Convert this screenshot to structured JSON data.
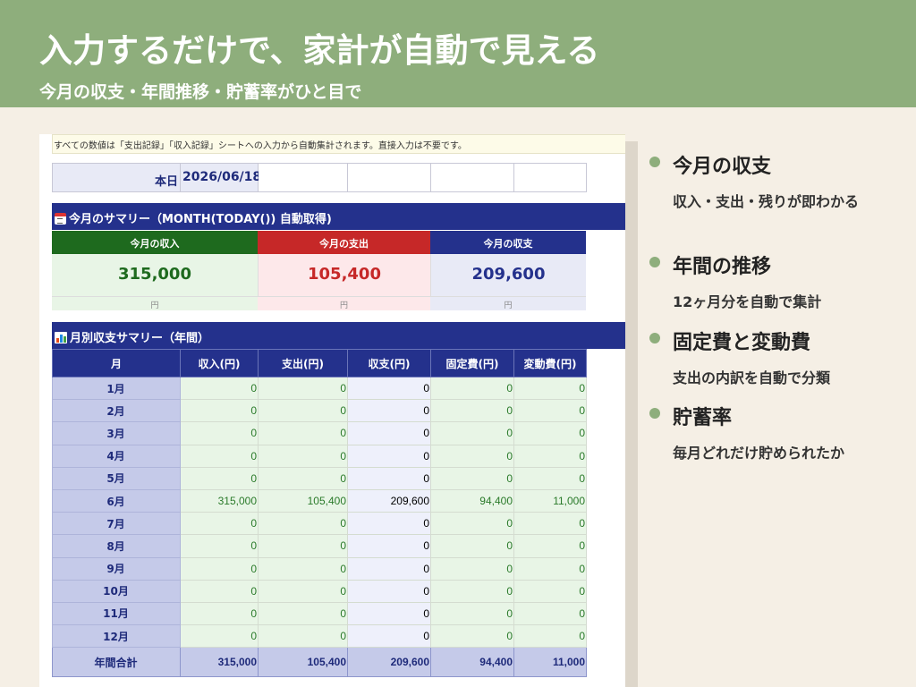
{
  "header": {
    "title": "入力するだけで、家計が自動で見える",
    "subtitle": "今月の収支・年間推移・貯蓄率がひと目で"
  },
  "sheet": {
    "note": "すべての数値は「支出記録」「収入記録」シートへの入力から自動集計されます。直接入力は不要です。",
    "date_label": "本日",
    "date_value": "2026/06/18",
    "monthly_section": {
      "icon": "calendar-icon",
      "title": "今月のサマリー（MONTH(TODAY()) 自動取得)",
      "cards": [
        {
          "label": "今月の収入",
          "value": "315,000",
          "unit": "円",
          "header_color": "#1e6a1e",
          "bg": "#e8f5e6",
          "value_color": "#1e6a1e"
        },
        {
          "label": "今月の支出",
          "value": "105,400",
          "unit": "円",
          "header_color": "#c62828",
          "bg": "#fde8ea",
          "value_color": "#c62828"
        },
        {
          "label": "今月の収支",
          "value": "209,600",
          "unit": "円",
          "header_color": "#24318c",
          "bg": "#e8eaf6",
          "value_color": "#24318c"
        }
      ]
    },
    "annual_section": {
      "icon": "bar-chart-icon",
      "title": "月別収支サマリー（年間）",
      "columns": [
        "月",
        "収入(円)",
        "支出(円)",
        "収支(円)",
        "固定費(円)",
        "変動費(円)"
      ],
      "rows": [
        [
          "1月",
          "0",
          "0",
          "0",
          "0",
          "0"
        ],
        [
          "2月",
          "0",
          "0",
          "0",
          "0",
          "0"
        ],
        [
          "3月",
          "0",
          "0",
          "0",
          "0",
          "0"
        ],
        [
          "4月",
          "0",
          "0",
          "0",
          "0",
          "0"
        ],
        [
          "5月",
          "0",
          "0",
          "0",
          "0",
          "0"
        ],
        [
          "6月",
          "315,000",
          "105,400",
          "209,600",
          "94,400",
          "11,000"
        ],
        [
          "7月",
          "0",
          "0",
          "0",
          "0",
          "0"
        ],
        [
          "8月",
          "0",
          "0",
          "0",
          "0",
          "0"
        ],
        [
          "9月",
          "0",
          "0",
          "0",
          "0",
          "0"
        ],
        [
          "10月",
          "0",
          "0",
          "0",
          "0",
          "0"
        ],
        [
          "11月",
          "0",
          "0",
          "0",
          "0",
          "0"
        ],
        [
          "12月",
          "0",
          "0",
          "0",
          "0",
          "0"
        ]
      ],
      "total": [
        "年間合計",
        "315,000",
        "105,400",
        "209,600",
        "94,400",
        "11,000"
      ]
    }
  },
  "bullets": [
    {
      "title": "今月の収支",
      "desc": "収入・支出・残りが即わかる"
    },
    {
      "title": "年間の推移",
      "desc": "12ヶ月分を自動で集計"
    },
    {
      "title": "固定費と変動費",
      "desc": "支出の内訳を自動で分類"
    },
    {
      "title": "貯蓄率",
      "desc": "毎月どれだけ貯められたか"
    }
  ]
}
